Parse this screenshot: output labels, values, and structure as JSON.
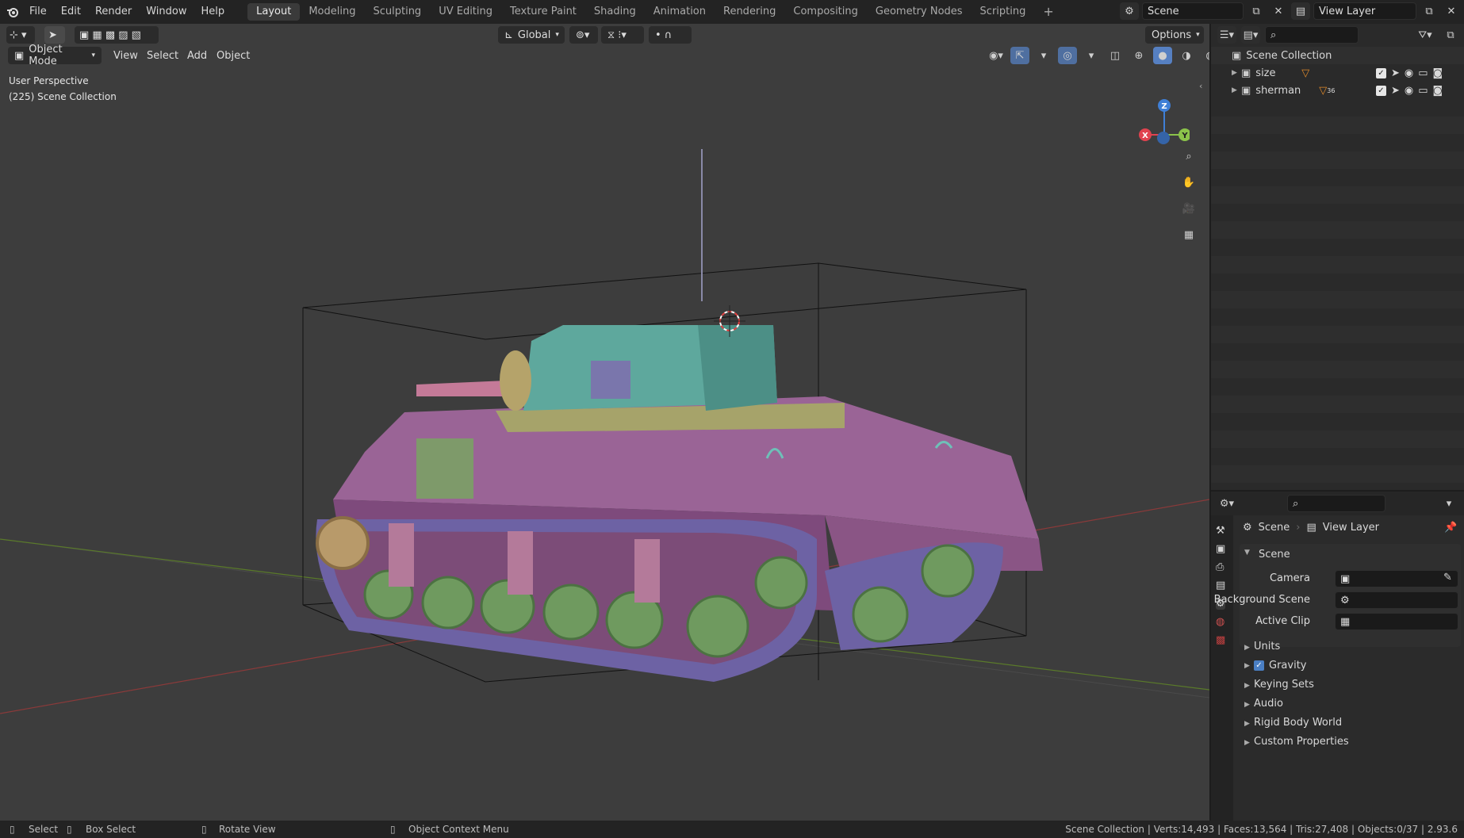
{
  "menus": [
    "File",
    "Edit",
    "Render",
    "Window",
    "Help"
  ],
  "workspaces": [
    "Layout",
    "Modeling",
    "Sculpting",
    "UV Editing",
    "Texture Paint",
    "Shading",
    "Animation",
    "Rendering",
    "Compositing",
    "Geometry Nodes",
    "Scripting"
  ],
  "active_workspace": "Layout",
  "scene_field": "Scene",
  "view_layer_field": "View Layer",
  "viewport": {
    "mode": "Object Mode",
    "menu": [
      "View",
      "Select",
      "Add",
      "Object"
    ],
    "orientation": "Global",
    "options": "Options",
    "overlay_line1": "User Perspective",
    "overlay_line2": "(225) Scene Collection",
    "gizmo": {
      "x": "X",
      "y": "Y",
      "z": "Z"
    }
  },
  "outliner": {
    "root": "Scene Collection",
    "items": [
      {
        "name": "size"
      },
      {
        "name": "sherman",
        "badge": "36"
      }
    ]
  },
  "properties": {
    "breadcrumb_scene": "Scene",
    "breadcrumb_viewlayer": "View Layer",
    "panel_title": "Scene",
    "camera_label": "Camera",
    "background_label": "Background Scene",
    "clip_label": "Active Clip",
    "sections": [
      "Units",
      "Gravity",
      "Keying Sets",
      "Audio",
      "Rigid Body World",
      "Custom Properties"
    ]
  },
  "statusbar": {
    "select": "Select",
    "box_select": "Box Select",
    "rotate": "Rotate View",
    "context": "Object Context Menu",
    "stats": "Scene Collection | Verts:14,493 | Faces:13,564 | Tris:27,408 | Objects:0/37 | 2.93.6"
  },
  "colors": {
    "hull": "#a06a9a",
    "turret": "#5fa39a",
    "track": "#6f63a6",
    "wheel": "#7ea06a",
    "axis_x": "#e0434f",
    "axis_y": "#8bc34a",
    "axis_z": "#3f7fd6"
  }
}
